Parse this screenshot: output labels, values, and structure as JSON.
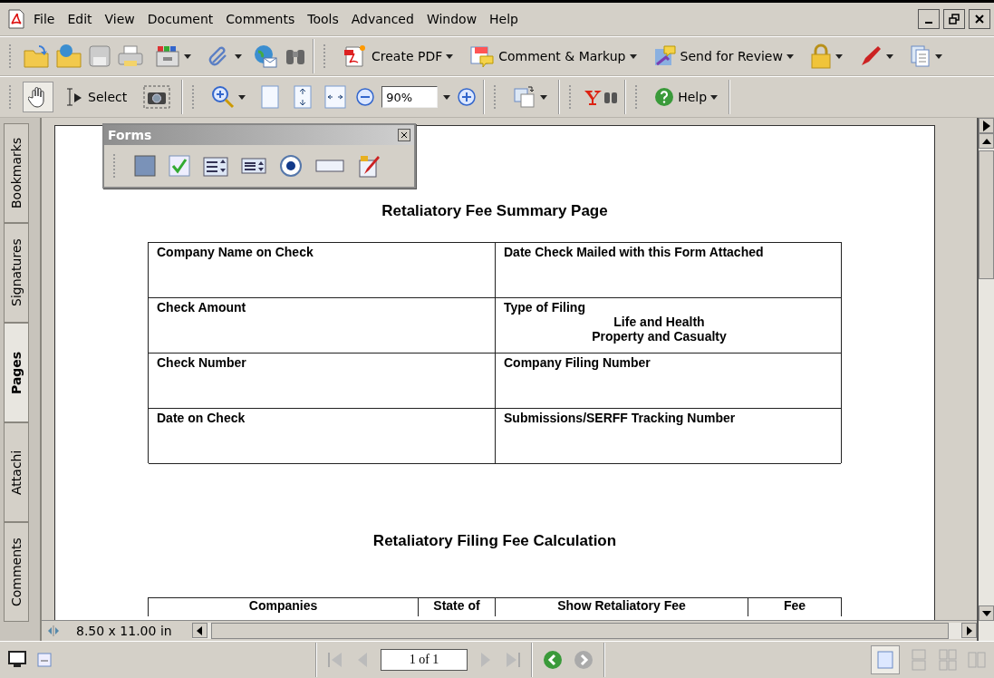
{
  "menu": [
    "File",
    "Edit",
    "View",
    "Document",
    "Comments",
    "Tools",
    "Advanced",
    "Window",
    "Help"
  ],
  "toolbar": {
    "task_buttons": [
      {
        "label": "Create PDF"
      },
      {
        "label": "Comment & Markup"
      },
      {
        "label": "Send for Review"
      }
    ]
  },
  "tools": [
    {
      "kind": "hand",
      "selected": true
    },
    {
      "kind": "select",
      "label": "Select",
      "selected": false
    },
    {
      "kind": "snapshot",
      "selected": false
    }
  ],
  "zoom": {
    "value": "90%"
  },
  "help_button": "Help",
  "side_tabs": [
    {
      "label": "Bookmarks",
      "selected": false
    },
    {
      "label": "Signatures",
      "selected": false
    },
    {
      "label": "Pages",
      "selected": true
    },
    {
      "label": "Attachi",
      "selected": false
    },
    {
      "label": "Comments",
      "selected": false
    }
  ],
  "forms_palette": {
    "title": "Forms"
  },
  "document": {
    "title": "Retaliatory Fee Summary Page",
    "summary_rows": [
      {
        "left": {
          "label": "Company Name on Check"
        },
        "right": {
          "label": "Date Check Mailed with this Form Attached"
        }
      },
      {
        "left": {
          "label": "Check Amount"
        },
        "right": {
          "label": "Type of Filing",
          "options": [
            "Life and Health",
            "Property and Casualty"
          ]
        }
      },
      {
        "left": {
          "label": "Check Number"
        },
        "right": {
          "label": "Company Filing Number"
        }
      },
      {
        "left": {
          "label": "Date on Check"
        },
        "right": {
          "label": "Submissions/SERFF Tracking Number"
        }
      }
    ],
    "calc_title": "Retaliatory Filing Fee Calculation",
    "calc_columns": [
      "Companies",
      "State of",
      "Show Retaliatory Fee",
      "Fee"
    ]
  },
  "status": {
    "page_size": "8.50 x 11.00 in",
    "page_field": "1 of 1"
  }
}
